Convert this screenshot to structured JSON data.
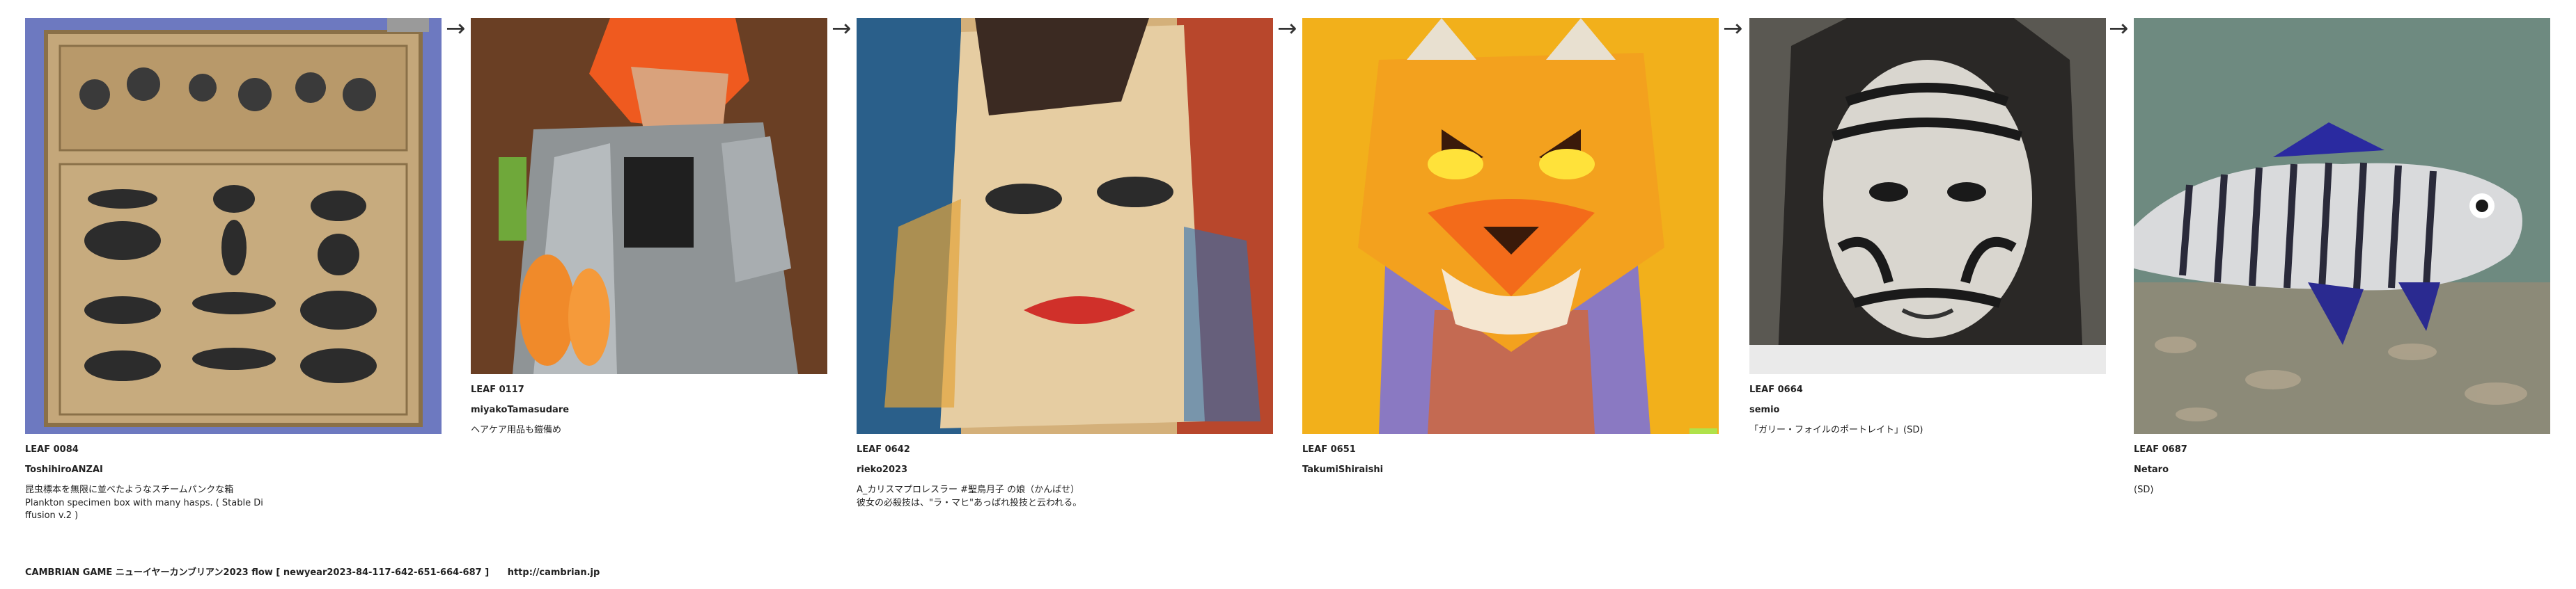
{
  "leaves": [
    {
      "id": "LEAF 0084",
      "author": "ToshihiroANZAI",
      "desc": "昆虫標本を無限に並べたようなスチームパンクな箱\nPlankton specimen box with many hasps. ( Stable Di\nffusion v.2 )"
    },
    {
      "id": "LEAF 0117",
      "author": "miyakoTamasudare",
      "desc": "ヘアケア用品も鎧備め"
    },
    {
      "id": "LEAF 0642",
      "author": "rieko2023",
      "desc": "A_カリスマプロレスラー #聖鳥月子 の娘（かんばせ）\n彼女の必殺技は、\"ラ・マヒ\"あっぱれ投技と云われる。"
    },
    {
      "id": "LEAF 0651",
      "author": "TakumiShiraishi",
      "desc": ""
    },
    {
      "id": "LEAF 0664",
      "author": "semio",
      "desc": "「ガリー・フォイルのポートレイト」(SD)"
    },
    {
      "id": "LEAF 0687",
      "author": "Netaro",
      "desc": "(SD)"
    }
  ],
  "arrow_glyph": "→",
  "footer": {
    "title": "CAMBRIAN GAME  ニューイヤーカンブリアン2023  flow [ newyear2023-84-117-642-651-664-687 ]",
    "url": "http://cambrian.jp"
  }
}
